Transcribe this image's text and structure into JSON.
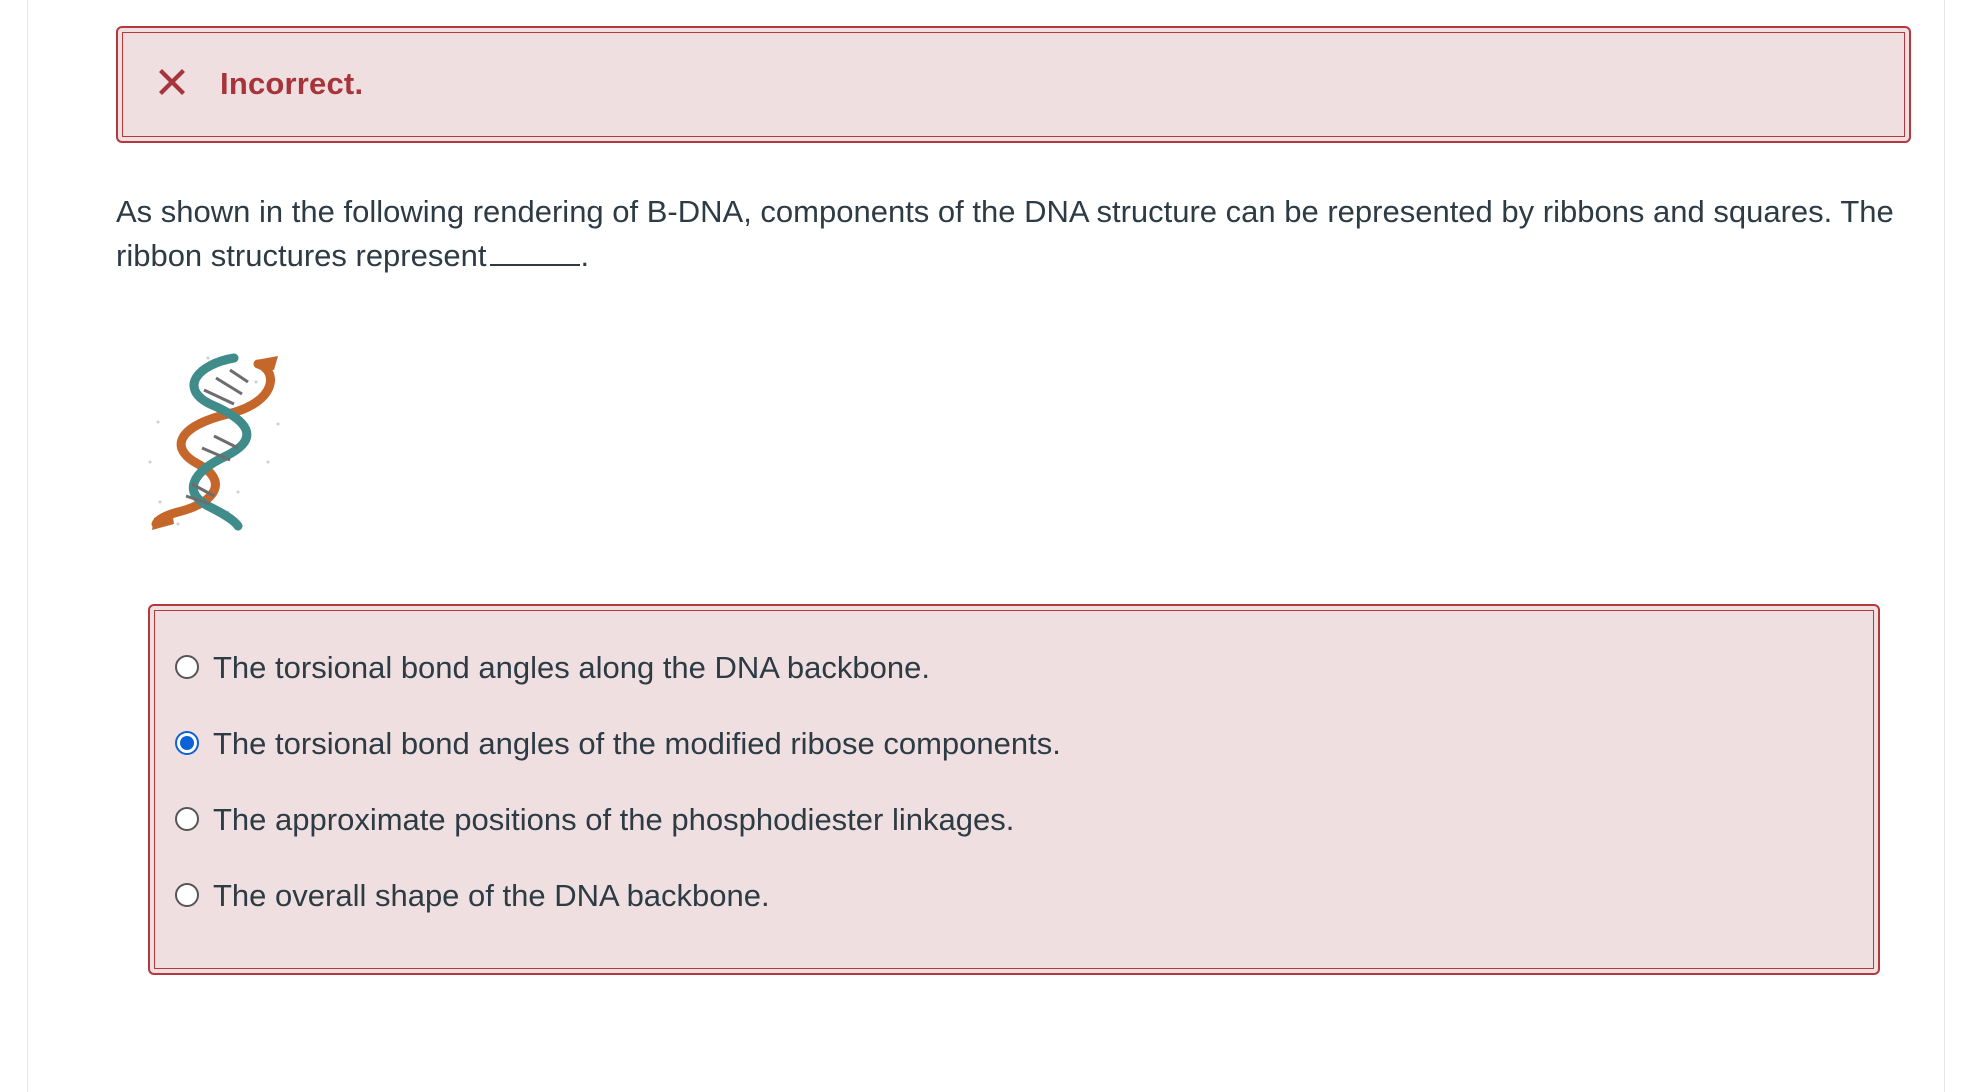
{
  "feedback": {
    "status_text": "Incorrect.",
    "icon": "close-x-icon",
    "color": "#a6343a",
    "background": "#efdfe0"
  },
  "question": {
    "text": "As shown in the following rendering of B-DNA, components of the DNA structure can be represented by ribbons and squares. The ribbon structures represent",
    "after_blank": "."
  },
  "figure": {
    "icon": "dna-double-helix-image"
  },
  "answers": [
    {
      "label": "The torsional bond angles along the DNA backbone.",
      "selected": false
    },
    {
      "label": "The torsional bond angles of the modified ribose components.",
      "selected": true
    },
    {
      "label": "The approximate positions of the phosphodiester linkages.",
      "selected": false
    },
    {
      "label": "The overall shape of the DNA backbone.",
      "selected": false
    }
  ],
  "colors": {
    "accent": "#0b62d6",
    "error_border": "#b5383d",
    "text": "#2d3b45"
  }
}
